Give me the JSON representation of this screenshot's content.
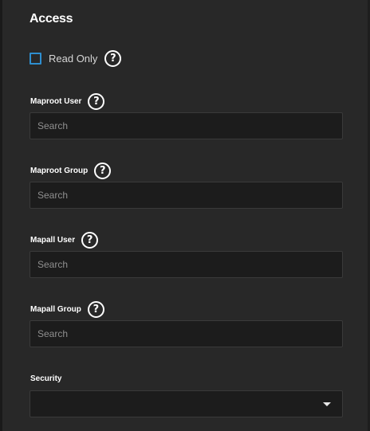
{
  "section": {
    "title": "Access"
  },
  "read_only": {
    "label": "Read Only",
    "checked": false,
    "help_glyph": "?"
  },
  "fields": {
    "maproot_user": {
      "label": "Maproot User",
      "placeholder": "Search",
      "help_glyph": "?"
    },
    "maproot_group": {
      "label": "Maproot Group",
      "placeholder": "Search",
      "help_glyph": "?"
    },
    "mapall_user": {
      "label": "Mapall User",
      "placeholder": "Search",
      "help_glyph": "?"
    },
    "mapall_group": {
      "label": "Mapall Group",
      "placeholder": "Search",
      "help_glyph": "?"
    },
    "security": {
      "label": "Security",
      "value": ""
    }
  },
  "colors": {
    "background": "#282828",
    "input_background": "#1c1c1c",
    "checkbox_accent": "#2e8ecf",
    "text": "#ffffff",
    "placeholder": "#8f8f8f"
  },
  "icons": {
    "help": "help-circle-icon",
    "dropdown": "caret-down-icon"
  }
}
